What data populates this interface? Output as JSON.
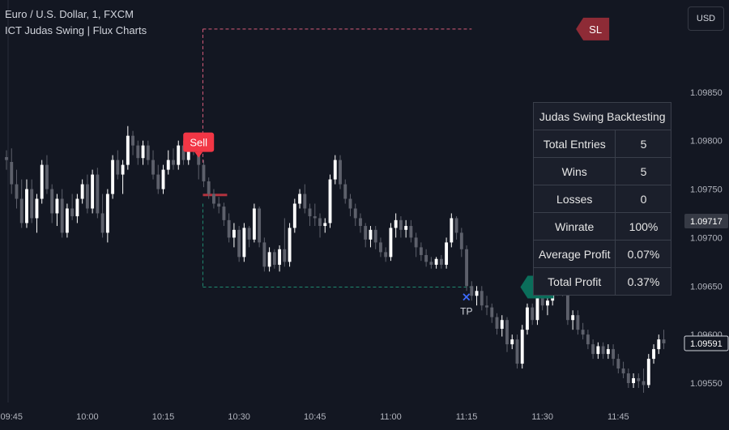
{
  "header": {
    "symbol_line": "Euro / U.S. Dollar, 1, FXCM",
    "indicator_line": "ICT Judas Swing | Flux Charts"
  },
  "currency_button": {
    "label": "USD"
  },
  "backtest_table": {
    "title": "Judas Swing Backtesting",
    "rows": [
      {
        "label": "Total Entries",
        "value": "5"
      },
      {
        "label": "Wins",
        "value": "5"
      },
      {
        "label": "Losses",
        "value": "0"
      },
      {
        "label": "Winrate",
        "value": "100%"
      },
      {
        "label": "Average Profit",
        "value": "0.07%"
      },
      {
        "label": "Total Profit",
        "value": "0.37%"
      }
    ]
  },
  "colors": {
    "background": "#131722",
    "bull_candle": "#ffffff",
    "bear_candle": "#5d606b",
    "sell_label": "#f23645",
    "sl_label": "#8e2b36",
    "tp_label": "#0b6e5b",
    "tp_cross": "#3d6bff",
    "sl_line": "#d65b7a",
    "tp_line": "#1f8a70",
    "entry_line": "#b2323e"
  },
  "chart_data": {
    "type": "candlestick",
    "title": "Euro / U.S. Dollar, 1, FXCM",
    "xlabel": "",
    "ylabel": "",
    "ylim": [
      1.0953,
      1.09945
    ],
    "y_ticks": [
      "1.09850",
      "1.09800",
      "1.09750",
      "1.09700",
      "1.09650",
      "1.09600",
      "1.09550"
    ],
    "x_ticks": [
      "09:45",
      "10:00",
      "10:15",
      "10:30",
      "10:45",
      "11:00",
      "11:15",
      "11:30",
      "11:45"
    ],
    "x_tick_minutes": [
      585,
      600,
      615,
      630,
      645,
      660,
      675,
      690,
      705
    ],
    "x_range_minutes": [
      584,
      716
    ],
    "price_markers": [
      {
        "label": "1.09717",
        "value": 1.09717,
        "style": "neutral"
      },
      {
        "label": "1.09591",
        "value": 1.09591,
        "style": "outline"
      }
    ],
    "candles": [
      {
        "t": 584,
        "o": 1.09783,
        "h": 1.0979,
        "l": 1.0977,
        "c": 1.0978
      },
      {
        "t": 585,
        "o": 1.09778,
        "h": 1.09792,
        "l": 1.09745,
        "c": 1.09755
      },
      {
        "t": 586,
        "o": 1.09755,
        "h": 1.0977,
        "l": 1.0973,
        "c": 1.0974
      },
      {
        "t": 587,
        "o": 1.0974,
        "h": 1.0976,
        "l": 1.0971,
        "c": 1.09715
      },
      {
        "t": 588,
        "o": 1.09715,
        "h": 1.0976,
        "l": 1.0971,
        "c": 1.0975
      },
      {
        "t": 589,
        "o": 1.0975,
        "h": 1.0976,
        "l": 1.09715,
        "c": 1.0972
      },
      {
        "t": 590,
        "o": 1.0972,
        "h": 1.09745,
        "l": 1.09705,
        "c": 1.0974
      },
      {
        "t": 591,
        "o": 1.0974,
        "h": 1.0978,
        "l": 1.09735,
        "c": 1.09775
      },
      {
        "t": 592,
        "o": 1.09775,
        "h": 1.09785,
        "l": 1.09745,
        "c": 1.0975
      },
      {
        "t": 593,
        "o": 1.0975,
        "h": 1.09755,
        "l": 1.09715,
        "c": 1.09725
      },
      {
        "t": 594,
        "o": 1.09725,
        "h": 1.09745,
        "l": 1.09712,
        "c": 1.0974
      },
      {
        "t": 595,
        "o": 1.0974,
        "h": 1.0975,
        "l": 1.097,
        "c": 1.09705
      },
      {
        "t": 596,
        "o": 1.09705,
        "h": 1.09735,
        "l": 1.097,
        "c": 1.0973
      },
      {
        "t": 597,
        "o": 1.0973,
        "h": 1.09745,
        "l": 1.09718,
        "c": 1.09722
      },
      {
        "t": 598,
        "o": 1.09722,
        "h": 1.09745,
        "l": 1.09715,
        "c": 1.0974
      },
      {
        "t": 599,
        "o": 1.0974,
        "h": 1.0976,
        "l": 1.09735,
        "c": 1.09755
      },
      {
        "t": 600,
        "o": 1.09755,
        "h": 1.09765,
        "l": 1.09725,
        "c": 1.0973
      },
      {
        "t": 601,
        "o": 1.0973,
        "h": 1.0977,
        "l": 1.09725,
        "c": 1.09765
      },
      {
        "t": 602,
        "o": 1.09765,
        "h": 1.09772,
        "l": 1.0972,
        "c": 1.09725
      },
      {
        "t": 603,
        "o": 1.09725,
        "h": 1.09745,
        "l": 1.097,
        "c": 1.09705
      },
      {
        "t": 604,
        "o": 1.09705,
        "h": 1.0975,
        "l": 1.09695,
        "c": 1.09745
      },
      {
        "t": 605,
        "o": 1.09745,
        "h": 1.09785,
        "l": 1.0974,
        "c": 1.0978
      },
      {
        "t": 606,
        "o": 1.0978,
        "h": 1.0979,
        "l": 1.0976,
        "c": 1.09765
      },
      {
        "t": 607,
        "o": 1.09765,
        "h": 1.0978,
        "l": 1.09745,
        "c": 1.09775
      },
      {
        "t": 608,
        "o": 1.09775,
        "h": 1.09815,
        "l": 1.0977,
        "c": 1.09805
      },
      {
        "t": 609,
        "o": 1.09805,
        "h": 1.0981,
        "l": 1.09785,
        "c": 1.09795
      },
      {
        "t": 610,
        "o": 1.09795,
        "h": 1.098,
        "l": 1.09775,
        "c": 1.09782
      },
      {
        "t": 611,
        "o": 1.09782,
        "h": 1.098,
        "l": 1.09775,
        "c": 1.09795
      },
      {
        "t": 612,
        "o": 1.09795,
        "h": 1.098,
        "l": 1.09775,
        "c": 1.0978
      },
      {
        "t": 613,
        "o": 1.0978,
        "h": 1.0979,
        "l": 1.0976,
        "c": 1.09765
      },
      {
        "t": 614,
        "o": 1.09765,
        "h": 1.09775,
        "l": 1.09745,
        "c": 1.0975
      },
      {
        "t": 615,
        "o": 1.0975,
        "h": 1.09775,
        "l": 1.09745,
        "c": 1.0977
      },
      {
        "t": 616,
        "o": 1.0977,
        "h": 1.0979,
        "l": 1.09765,
        "c": 1.0978
      },
      {
        "t": 617,
        "o": 1.0978,
        "h": 1.09792,
        "l": 1.0977,
        "c": 1.09775
      },
      {
        "t": 618,
        "o": 1.09775,
        "h": 1.098,
        "l": 1.0977,
        "c": 1.09795
      },
      {
        "t": 619,
        "o": 1.09795,
        "h": 1.098,
        "l": 1.09775,
        "c": 1.0978
      },
      {
        "t": 620,
        "o": 1.0978,
        "h": 1.098,
        "l": 1.09775,
        "c": 1.09795
      },
      {
        "t": 621,
        "o": 1.09795,
        "h": 1.09802,
        "l": 1.09785,
        "c": 1.0979
      },
      {
        "t": 622,
        "o": 1.0979,
        "h": 1.09792,
        "l": 1.0976,
        "c": 1.09775
      },
      {
        "t": 623,
        "o": 1.09775,
        "h": 1.0978,
        "l": 1.09752,
        "c": 1.09758
      },
      {
        "t": 624,
        "o": 1.09758,
        "h": 1.09762,
        "l": 1.0974,
        "c": 1.09745
      },
      {
        "t": 625,
        "o": 1.09745,
        "h": 1.0975,
        "l": 1.0973,
        "c": 1.09735
      },
      {
        "t": 626,
        "o": 1.09735,
        "h": 1.09742,
        "l": 1.09725,
        "c": 1.09732
      },
      {
        "t": 627,
        "o": 1.09732,
        "h": 1.09736,
        "l": 1.09712,
        "c": 1.09718
      },
      {
        "t": 628,
        "o": 1.09718,
        "h": 1.09725,
        "l": 1.09695,
        "c": 1.097
      },
      {
        "t": 629,
        "o": 1.097,
        "h": 1.09715,
        "l": 1.0969,
        "c": 1.09708
      },
      {
        "t": 630,
        "o": 1.09708,
        "h": 1.09712,
        "l": 1.09675,
        "c": 1.0968
      },
      {
        "t": 631,
        "o": 1.0968,
        "h": 1.09715,
        "l": 1.09675,
        "c": 1.0971
      },
      {
        "t": 632,
        "o": 1.0971,
        "h": 1.09712,
        "l": 1.0969,
        "c": 1.09698
      },
      {
        "t": 633,
        "o": 1.09698,
        "h": 1.09735,
        "l": 1.09695,
        "c": 1.0973
      },
      {
        "t": 634,
        "o": 1.0973,
        "h": 1.09732,
        "l": 1.0969,
        "c": 1.09695
      },
      {
        "t": 635,
        "o": 1.09695,
        "h": 1.097,
        "l": 1.09665,
        "c": 1.0967
      },
      {
        "t": 636,
        "o": 1.0967,
        "h": 1.0969,
        "l": 1.09665,
        "c": 1.09685
      },
      {
        "t": 637,
        "o": 1.09685,
        "h": 1.09688,
        "l": 1.09668,
        "c": 1.09672
      },
      {
        "t": 638,
        "o": 1.09672,
        "h": 1.09692,
        "l": 1.09665,
        "c": 1.09688
      },
      {
        "t": 639,
        "o": 1.09688,
        "h": 1.0972,
        "l": 1.0967,
        "c": 1.09675
      },
      {
        "t": 640,
        "o": 1.09675,
        "h": 1.09715,
        "l": 1.0967,
        "c": 1.0971
      },
      {
        "t": 641,
        "o": 1.0971,
        "h": 1.0974,
        "l": 1.09705,
        "c": 1.09735
      },
      {
        "t": 642,
        "o": 1.09735,
        "h": 1.0975,
        "l": 1.0973,
        "c": 1.09745
      },
      {
        "t": 643,
        "o": 1.09745,
        "h": 1.09755,
        "l": 1.09725,
        "c": 1.0973
      },
      {
        "t": 644,
        "o": 1.0973,
        "h": 1.09735,
        "l": 1.09712,
        "c": 1.09722
      },
      {
        "t": 645,
        "o": 1.09722,
        "h": 1.09735,
        "l": 1.09712,
        "c": 1.0972
      },
      {
        "t": 646,
        "o": 1.0972,
        "h": 1.09725,
        "l": 1.097,
        "c": 1.09712
      },
      {
        "t": 647,
        "o": 1.09712,
        "h": 1.0972,
        "l": 1.09705,
        "c": 1.09715
      },
      {
        "t": 648,
        "o": 1.09715,
        "h": 1.09765,
        "l": 1.0971,
        "c": 1.0976
      },
      {
        "t": 649,
        "o": 1.0976,
        "h": 1.09785,
        "l": 1.09755,
        "c": 1.0978
      },
      {
        "t": 650,
        "o": 1.0978,
        "h": 1.09785,
        "l": 1.0975,
        "c": 1.09755
      },
      {
        "t": 651,
        "o": 1.09755,
        "h": 1.0976,
        "l": 1.09735,
        "c": 1.0974
      },
      {
        "t": 652,
        "o": 1.0974,
        "h": 1.09745,
        "l": 1.09722,
        "c": 1.0973
      },
      {
        "t": 653,
        "o": 1.0973,
        "h": 1.09735,
        "l": 1.09712,
        "c": 1.0972
      },
      {
        "t": 654,
        "o": 1.0972,
        "h": 1.09725,
        "l": 1.09705,
        "c": 1.09712
      },
      {
        "t": 655,
        "o": 1.09712,
        "h": 1.09715,
        "l": 1.0969,
        "c": 1.09698
      },
      {
        "t": 656,
        "o": 1.09698,
        "h": 1.09712,
        "l": 1.0969,
        "c": 1.09708
      },
      {
        "t": 657,
        "o": 1.09708,
        "h": 1.09712,
        "l": 1.09688,
        "c": 1.09695
      },
      {
        "t": 658,
        "o": 1.09695,
        "h": 1.097,
        "l": 1.0968,
        "c": 1.09685
      },
      {
        "t": 659,
        "o": 1.09685,
        "h": 1.0969,
        "l": 1.09675,
        "c": 1.0968
      },
      {
        "t": 660,
        "o": 1.0968,
        "h": 1.09715,
        "l": 1.09676,
        "c": 1.0971
      },
      {
        "t": 661,
        "o": 1.0971,
        "h": 1.09725,
        "l": 1.097,
        "c": 1.09718
      },
      {
        "t": 662,
        "o": 1.09718,
        "h": 1.09722,
        "l": 1.097,
        "c": 1.09708
      },
      {
        "t": 663,
        "o": 1.09708,
        "h": 1.09718,
        "l": 1.097,
        "c": 1.09712
      },
      {
        "t": 664,
        "o": 1.09712,
        "h": 1.09718,
        "l": 1.09695,
        "c": 1.097
      },
      {
        "t": 665,
        "o": 1.097,
        "h": 1.09705,
        "l": 1.0968,
        "c": 1.0969
      },
      {
        "t": 666,
        "o": 1.0969,
        "h": 1.09695,
        "l": 1.09676,
        "c": 1.09682
      },
      {
        "t": 667,
        "o": 1.09682,
        "h": 1.09688,
        "l": 1.0967,
        "c": 1.09675
      },
      {
        "t": 668,
        "o": 1.09675,
        "h": 1.0968,
        "l": 1.09668,
        "c": 1.09672
      },
      {
        "t": 669,
        "o": 1.09672,
        "h": 1.0968,
        "l": 1.09668,
        "c": 1.09678
      },
      {
        "t": 670,
        "o": 1.09678,
        "h": 1.09682,
        "l": 1.09668,
        "c": 1.09672
      },
      {
        "t": 671,
        "o": 1.09672,
        "h": 1.097,
        "l": 1.09668,
        "c": 1.09695
      },
      {
        "t": 672,
        "o": 1.09695,
        "h": 1.09725,
        "l": 1.0969,
        "c": 1.0972
      },
      {
        "t": 673,
        "o": 1.0972,
        "h": 1.09722,
        "l": 1.09698,
        "c": 1.09705
      },
      {
        "t": 674,
        "o": 1.09705,
        "h": 1.0971,
        "l": 1.0968,
        "c": 1.09688
      },
      {
        "t": 675,
        "o": 1.09688,
        "h": 1.09692,
        "l": 1.09645,
        "c": 1.0965
      },
      {
        "t": 676,
        "o": 1.0965,
        "h": 1.09655,
        "l": 1.09635,
        "c": 1.0964
      },
      {
        "t": 677,
        "o": 1.0964,
        "h": 1.0965,
        "l": 1.0963,
        "c": 1.09645
      },
      {
        "t": 678,
        "o": 1.09645,
        "h": 1.0965,
        "l": 1.09625,
        "c": 1.0963
      },
      {
        "t": 679,
        "o": 1.0963,
        "h": 1.0964,
        "l": 1.0962,
        "c": 1.09628
      },
      {
        "t": 680,
        "o": 1.09628,
        "h": 1.09632,
        "l": 1.09612,
        "c": 1.09618
      },
      {
        "t": 681,
        "o": 1.09618,
        "h": 1.09622,
        "l": 1.096,
        "c": 1.09606
      },
      {
        "t": 682,
        "o": 1.09606,
        "h": 1.0962,
        "l": 1.09598,
        "c": 1.09615
      },
      {
        "t": 683,
        "o": 1.09615,
        "h": 1.09618,
        "l": 1.09582,
        "c": 1.0959
      },
      {
        "t": 684,
        "o": 1.0959,
        "h": 1.096,
        "l": 1.09585,
        "c": 1.09595
      },
      {
        "t": 685,
        "o": 1.09595,
        "h": 1.096,
        "l": 1.09565,
        "c": 1.0957
      },
      {
        "t": 686,
        "o": 1.0957,
        "h": 1.0961,
        "l": 1.09565,
        "c": 1.09605
      },
      {
        "t": 687,
        "o": 1.09605,
        "h": 1.09632,
        "l": 1.096,
        "c": 1.09628
      },
      {
        "t": 688,
        "o": 1.09628,
        "h": 1.09632,
        "l": 1.0961,
        "c": 1.09615
      },
      {
        "t": 689,
        "o": 1.09615,
        "h": 1.0965,
        "l": 1.0961,
        "c": 1.09645
      },
      {
        "t": 690,
        "o": 1.09645,
        "h": 1.0965,
        "l": 1.09625,
        "c": 1.0963
      },
      {
        "t": 691,
        "o": 1.0963,
        "h": 1.0964,
        "l": 1.0962,
        "c": 1.09635
      },
      {
        "t": 692,
        "o": 1.09635,
        "h": 1.09665,
        "l": 1.0963,
        "c": 1.0966
      },
      {
        "t": 693,
        "o": 1.0966,
        "h": 1.09665,
        "l": 1.0964,
        "c": 1.09648
      },
      {
        "t": 694,
        "o": 1.09648,
        "h": 1.09655,
        "l": 1.0964,
        "c": 1.0965
      },
      {
        "t": 695,
        "o": 1.0965,
        "h": 1.09655,
        "l": 1.0961,
        "c": 1.09615
      },
      {
        "t": 696,
        "o": 1.09615,
        "h": 1.09625,
        "l": 1.09605,
        "c": 1.0962
      },
      {
        "t": 697,
        "o": 1.0962,
        "h": 1.09625,
        "l": 1.096,
        "c": 1.09605
      },
      {
        "t": 698,
        "o": 1.09605,
        "h": 1.09612,
        "l": 1.09595,
        "c": 1.096
      },
      {
        "t": 699,
        "o": 1.096,
        "h": 1.09605,
        "l": 1.09585,
        "c": 1.0959
      },
      {
        "t": 700,
        "o": 1.0959,
        "h": 1.09595,
        "l": 1.09575,
        "c": 1.0958
      },
      {
        "t": 701,
        "o": 1.0958,
        "h": 1.09592,
        "l": 1.09575,
        "c": 1.09588
      },
      {
        "t": 702,
        "o": 1.09588,
        "h": 1.09592,
        "l": 1.09575,
        "c": 1.0958
      },
      {
        "t": 703,
        "o": 1.0958,
        "h": 1.0959,
        "l": 1.09575,
        "c": 1.09585
      },
      {
        "t": 704,
        "o": 1.09585,
        "h": 1.0959,
        "l": 1.09568,
        "c": 1.09575
      },
      {
        "t": 705,
        "o": 1.09575,
        "h": 1.0958,
        "l": 1.0956,
        "c": 1.09565
      },
      {
        "t": 706,
        "o": 1.09565,
        "h": 1.09572,
        "l": 1.09555,
        "c": 1.0956
      },
      {
        "t": 707,
        "o": 1.0956,
        "h": 1.09565,
        "l": 1.09545,
        "c": 1.0955
      },
      {
        "t": 708,
        "o": 1.0955,
        "h": 1.0956,
        "l": 1.09545,
        "c": 1.09555
      },
      {
        "t": 709,
        "o": 1.09555,
        "h": 1.0956,
        "l": 1.09545,
        "c": 1.09552
      },
      {
        "t": 710,
        "o": 1.09552,
        "h": 1.09565,
        "l": 1.0954,
        "c": 1.09548
      },
      {
        "t": 711,
        "o": 1.09548,
        "h": 1.0958,
        "l": 1.09545,
        "c": 1.09575
      },
      {
        "t": 712,
        "o": 1.09575,
        "h": 1.0959,
        "l": 1.0957,
        "c": 1.09585
      },
      {
        "t": 713,
        "o": 1.09585,
        "h": 1.096,
        "l": 1.0958,
        "c": 1.09595
      },
      {
        "t": 714,
        "o": 1.09595,
        "h": 1.09605,
        "l": 1.09585,
        "c": 1.09591
      }
    ],
    "annotations": [
      {
        "type": "label",
        "text": "Sell",
        "t": 622,
        "price": 1.09785,
        "color_key": "sell_label"
      },
      {
        "type": "label",
        "text": "SL",
        "t": 700,
        "price": 1.09915,
        "color_key": "sl_label"
      },
      {
        "type": "label",
        "text": "TP",
        "t": 689,
        "price": 1.09649,
        "color_key": "tp_label"
      },
      {
        "type": "marker",
        "text": "TP",
        "symbol": "×",
        "t": 674,
        "price": 1.0964
      },
      {
        "type": "level",
        "name": "stop-loss-line",
        "price": 1.09915,
        "t_start": 623,
        "t_end": 676,
        "color_key": "sl_line"
      },
      {
        "type": "level",
        "name": "take-profit-line",
        "price": 1.09649,
        "t_start": 623,
        "t_end": 676,
        "color_key": "tp_line"
      },
      {
        "type": "level",
        "name": "entry-line",
        "price": 1.09744,
        "t_start": 623,
        "t_end": 627,
        "color_key": "entry_line"
      }
    ]
  }
}
